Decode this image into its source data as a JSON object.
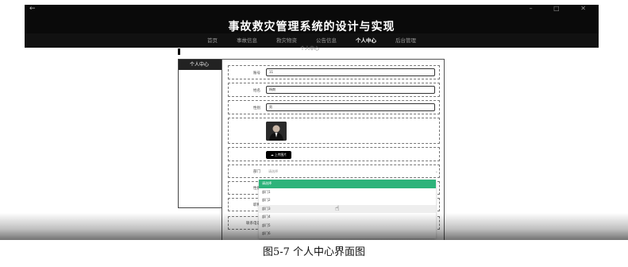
{
  "window": {
    "back_glyph": "←",
    "controls": "– □ ✕"
  },
  "app": {
    "title": "事故救灾管理系统的设计与实现"
  },
  "nav": {
    "items": [
      {
        "label": "首页"
      },
      {
        "label": "事故信息"
      },
      {
        "label": "救灾物资"
      },
      {
        "label": "公告信息"
      },
      {
        "label": "个人中心",
        "active": true
      },
      {
        "label": "后台管理"
      }
    ]
  },
  "page": {
    "heading": "个人中心"
  },
  "sidebar": {
    "header": "个人中心"
  },
  "form": {
    "account": {
      "label": "账号",
      "value": "11"
    },
    "name": {
      "label": "姓名",
      "value": "杨朗"
    },
    "gender": {
      "label": "性别",
      "value": "男"
    },
    "upload_label": "上传图片",
    "department": {
      "label": "部门",
      "placeholder": "请选择"
    },
    "row6_label": "性别",
    "row7_label": "职称",
    "row8_label": "联系电话"
  },
  "dropdown": {
    "options": [
      "请选择",
      "部门1",
      "部门2",
      "部门3",
      "部门4",
      "部门5",
      "部门6"
    ],
    "selected_index": 0,
    "hovered_index": 3,
    "accent": "#2db37a"
  },
  "caption": "图5-7 个人中心界面图"
}
